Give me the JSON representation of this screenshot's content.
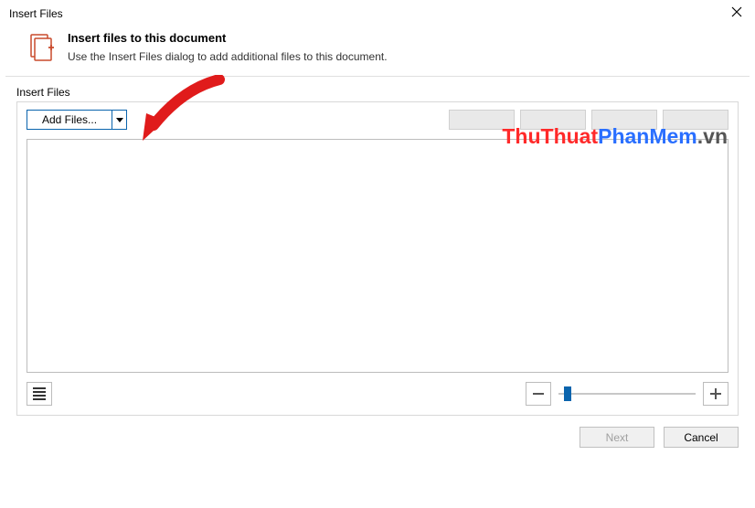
{
  "window": {
    "title": "Insert Files"
  },
  "header": {
    "title": "Insert files to this document",
    "description": "Use the Insert Files dialog to add additional files to this document."
  },
  "section": {
    "label": "Insert Files"
  },
  "toolbar": {
    "add_files_label": "Add Files..."
  },
  "footer": {
    "next": "Next",
    "cancel": "Cancel"
  },
  "watermark": {
    "part1": "ThuThuat",
    "part2": "PhanMem",
    "part3": ".vn"
  },
  "icons": {
    "close": "close-icon",
    "document": "document-icon",
    "dropdown": "chevron-down-icon",
    "list": "list-icon",
    "minus": "minus-icon",
    "plus": "plus-icon"
  }
}
